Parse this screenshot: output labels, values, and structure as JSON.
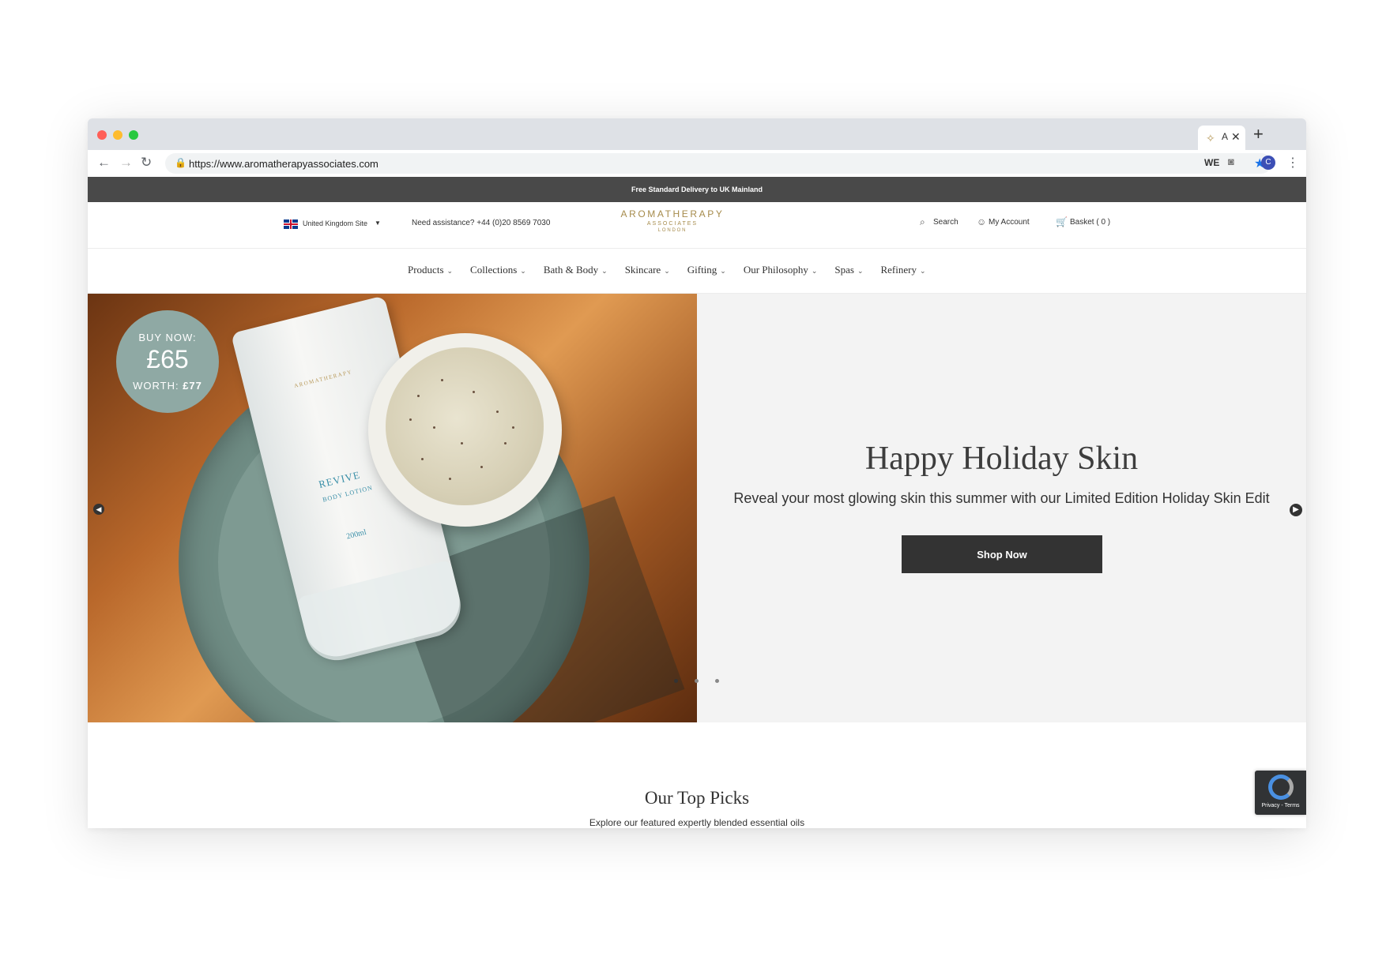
{
  "browser": {
    "tab_title": "A",
    "url": "https://www.aromatherapyassociates.com",
    "profile_initial": "C",
    "extension_label": "WE"
  },
  "promo_bar": {
    "text": "Free Standard Delivery to UK Mainland"
  },
  "header": {
    "site_selector": "United Kingdom Site",
    "assistance": "Need assistance? +44 (0)20 8569 7030",
    "logo": {
      "line1": "AROMATHERAPY",
      "line2": "ASSOCIATES",
      "line3": "LONDON"
    },
    "search_label": "Search",
    "account_label": "My Account",
    "basket_label": "Basket ( 0 )"
  },
  "nav": {
    "items": [
      {
        "label": "Products"
      },
      {
        "label": "Collections"
      },
      {
        "label": "Bath & Body"
      },
      {
        "label": "Skincare"
      },
      {
        "label": "Gifting"
      },
      {
        "label": "Our Philosophy"
      },
      {
        "label": "Spas"
      },
      {
        "label": "Refinery"
      }
    ]
  },
  "hero": {
    "badge": {
      "line1": "BUY NOW:",
      "price": "£65",
      "worth_label": "WORTH:",
      "worth_value": "£77"
    },
    "product": {
      "brand": "AROMATHERAPY",
      "name": "REVIVE",
      "type": "BODY LOTION",
      "size": "200ml"
    },
    "title": "Happy Holiday Skin",
    "subtitle": "Reveal your most glowing skin this summer with our Limited Edition Holiday Skin Edit",
    "cta_label": "Shop Now"
  },
  "top_picks": {
    "title": "Our Top Picks",
    "subtitle": "Explore our featured expertly blended essential oils"
  },
  "recaptcha": {
    "text": "Privacy - Terms"
  },
  "colors": {
    "accent_gold": "#a68b4b",
    "badge": "#8fa9a4",
    "dark": "#333333",
    "promo": "#494949"
  }
}
